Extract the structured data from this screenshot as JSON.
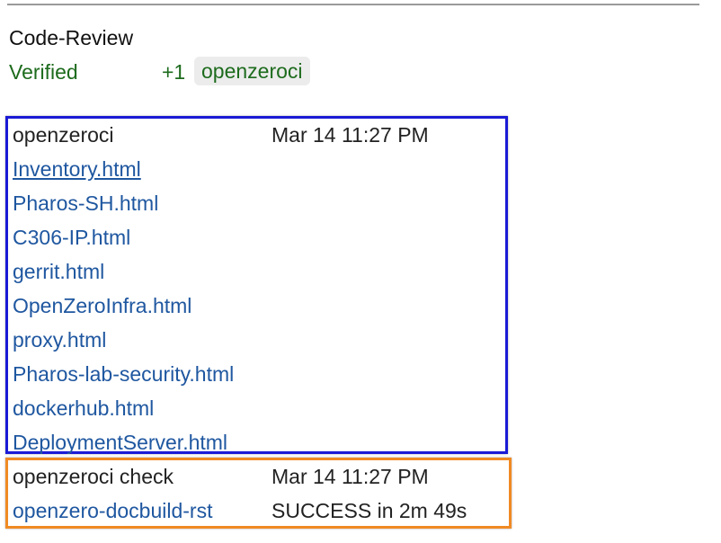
{
  "labels": {
    "code_review": "Code-Review",
    "verified": "Verified",
    "verified_vote": "+1",
    "verified_by": "openzeroci"
  },
  "messages": [
    {
      "author": "openzeroci",
      "time": "Mar 14 11:27 PM",
      "files": [
        "Inventory.html",
        "Pharos-SH.html",
        "C306-IP.html",
        "gerrit.html",
        "OpenZeroInfra.html",
        "proxy.html",
        "Pharos-lab-security.html",
        "dockerhub.html",
        "DeploymentServer.html"
      ]
    },
    {
      "author": "openzeroci check",
      "time": "Mar 14 11:27 PM",
      "job": "openzero-docbuild-rst",
      "result": "SUCCESS in 2m 49s"
    }
  ],
  "colors": {
    "link": "#1f57a0",
    "verified_green": "#1d6b1d",
    "blue_box": "#1a1ad6",
    "orange_box": "#f08a24",
    "chip_bg": "#ececec"
  }
}
